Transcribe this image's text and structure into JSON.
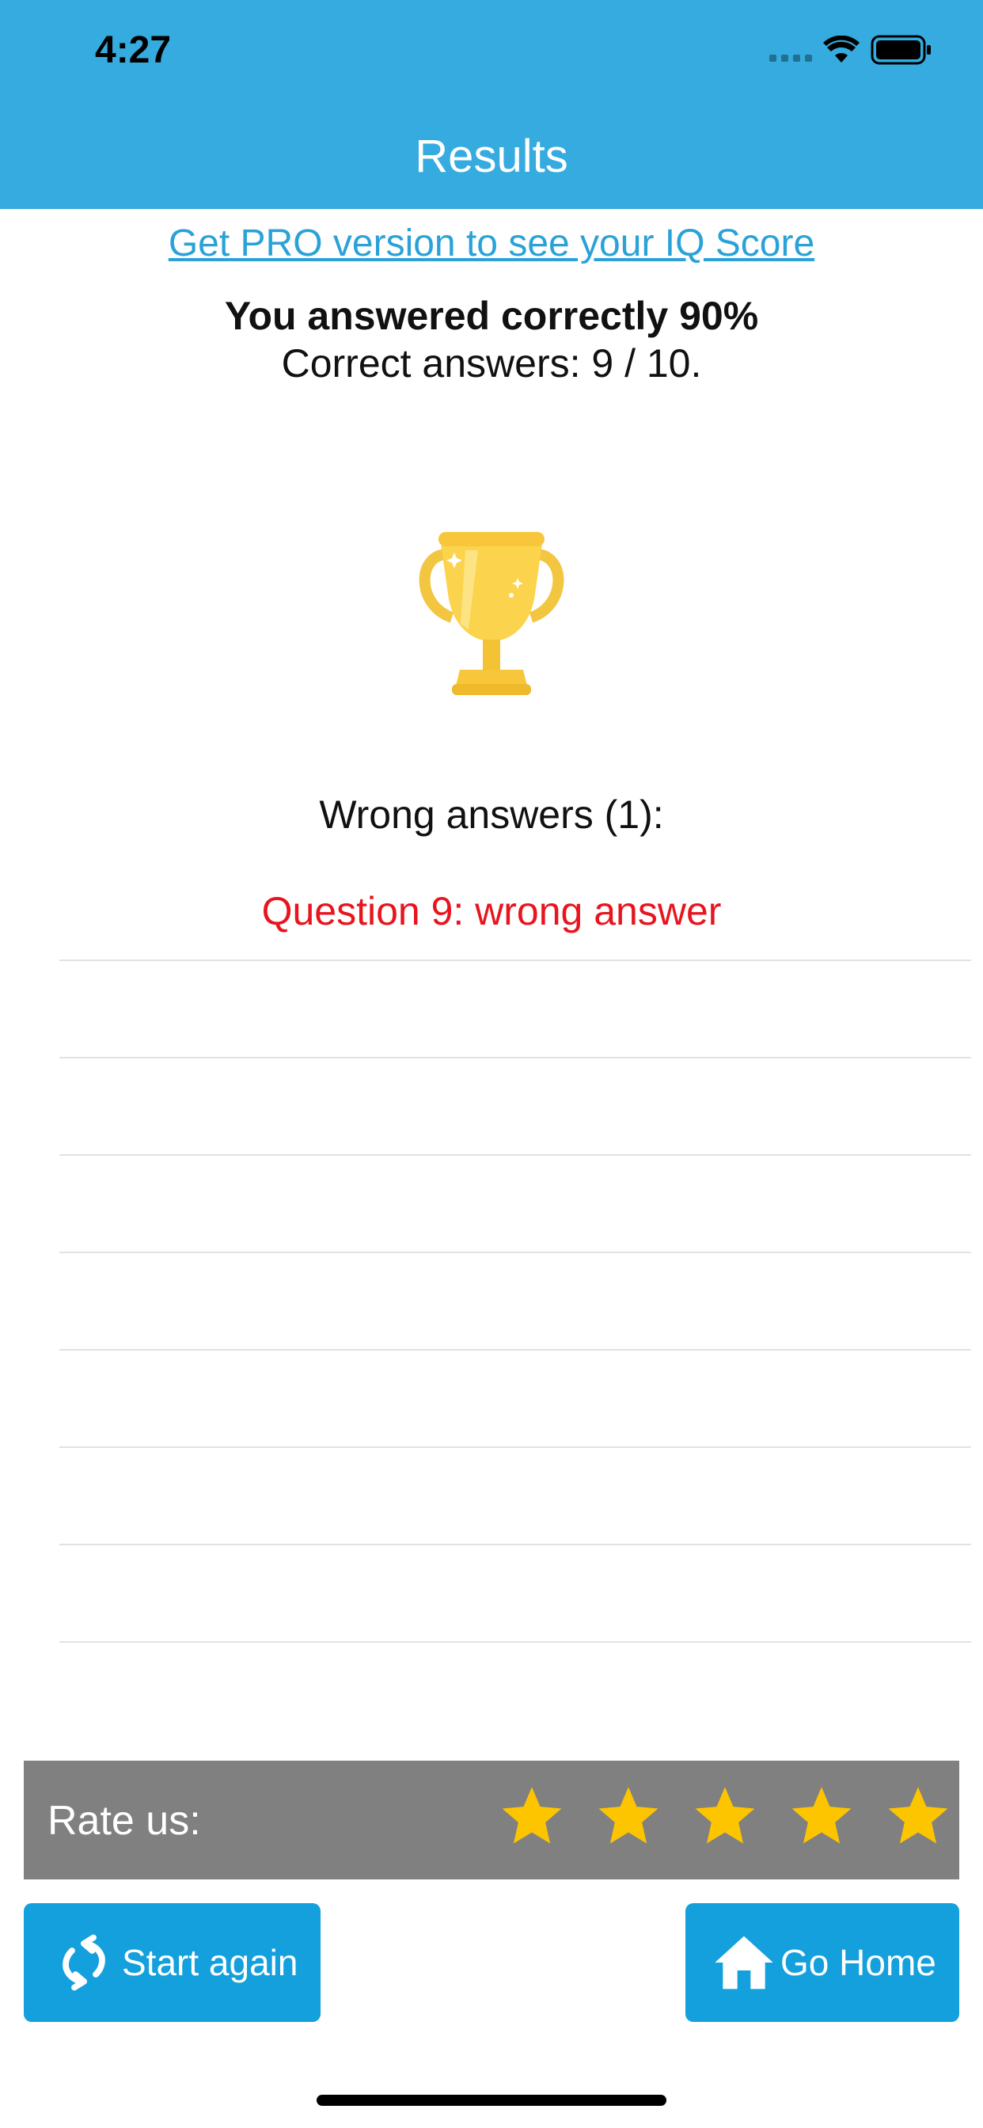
{
  "status_bar": {
    "time": "4:27"
  },
  "header": {
    "title": "Results",
    "background": "#35abe0"
  },
  "promo": {
    "link": "Get PRO version to see your IQ Score"
  },
  "summary": {
    "score": "You answered correctly 90%",
    "correct": "Correct answers: 9 / 10."
  },
  "trophy_icon": "trophy-icon",
  "wrong": {
    "title": "Wrong answers (1):",
    "items": [
      "Question 9: wrong answer"
    ],
    "item_color": "#e8141e"
  },
  "rating": {
    "label": "Rate us:",
    "stars": 5,
    "star_color": "#fdc400"
  },
  "actions": {
    "start_again": "Start again",
    "go_home": "Go Home",
    "color": "#13a0dc"
  }
}
